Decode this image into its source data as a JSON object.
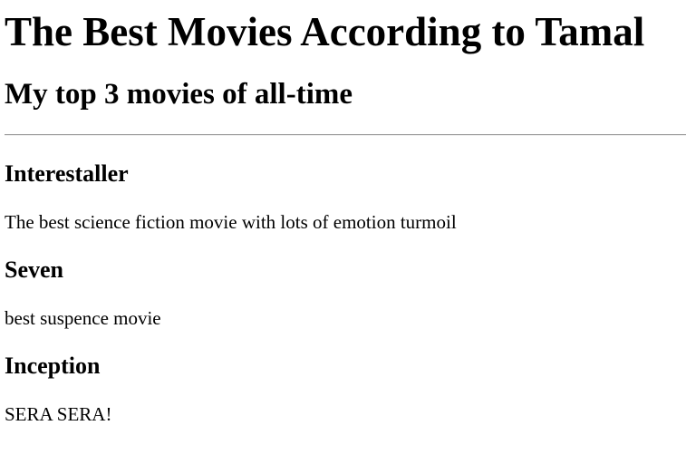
{
  "page": {
    "title": "The Best Movies According to Tamal",
    "subtitle": "My top 3 movies of all-time"
  },
  "movies": [
    {
      "title": "Interestaller",
      "description": "The best science fiction movie with lots of emotion turmoil"
    },
    {
      "title": "Seven",
      "description": "best suspence movie"
    },
    {
      "title": "Inception",
      "description": "SERA SERA!"
    }
  ]
}
